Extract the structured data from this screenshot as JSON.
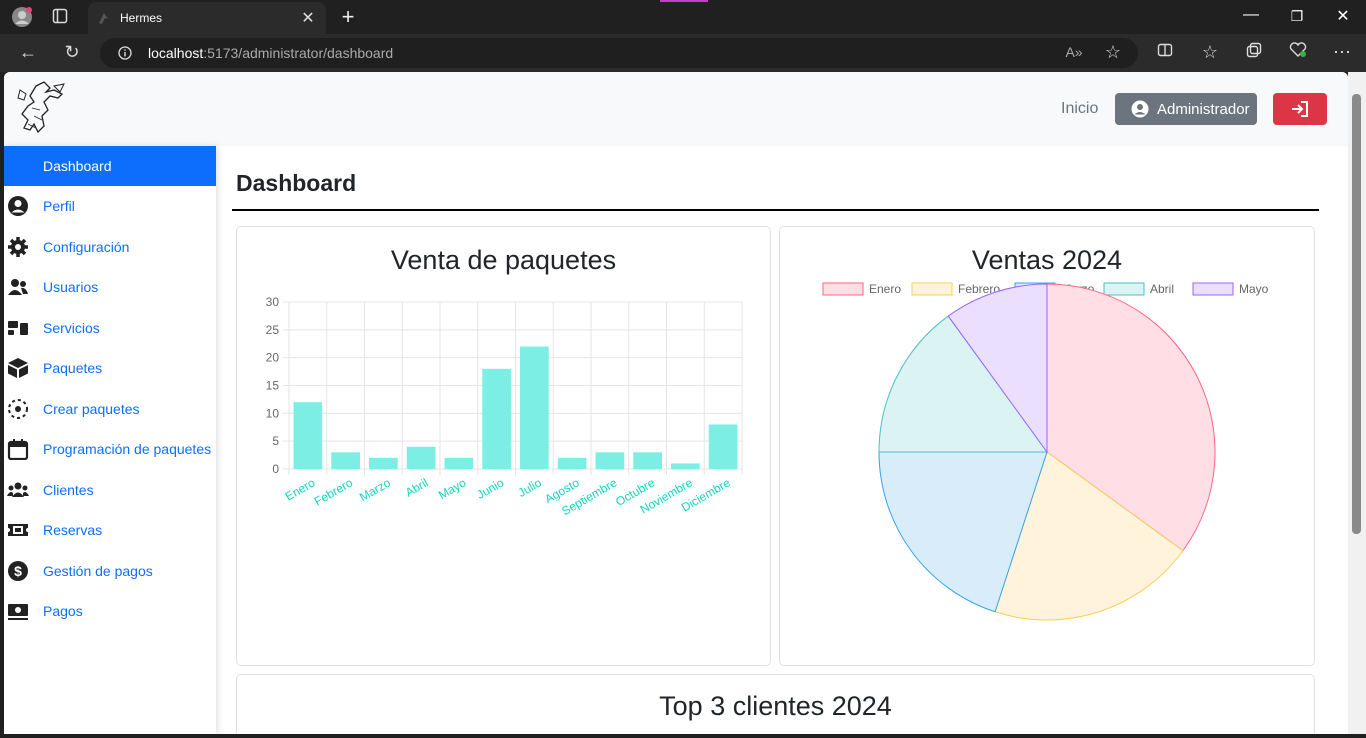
{
  "browser": {
    "tab_title": "Hermes",
    "url_host": "localhost",
    "url_path": ":5173/administrator/dashboard"
  },
  "topnav": {
    "inicio": "Inicio",
    "admin_label": "Administrador"
  },
  "sidebar": {
    "items": [
      {
        "label": "Dashboard",
        "icon": "chart-pie-icon"
      },
      {
        "label": "Perfil",
        "icon": "user-circle-icon"
      },
      {
        "label": "Configuración",
        "icon": "gear-icon"
      },
      {
        "label": "Usuarios",
        "icon": "users-icon"
      },
      {
        "label": "Servicios",
        "icon": "services-icon"
      },
      {
        "label": "Paquetes",
        "icon": "box-icon"
      },
      {
        "label": "Crear paquetes",
        "icon": "create-package-icon"
      },
      {
        "label": "Programación de paquetes",
        "icon": "calendar-icon"
      },
      {
        "label": "Clientes",
        "icon": "clients-icon"
      },
      {
        "label": "Reservas",
        "icon": "ticket-icon"
      },
      {
        "label": "Gestión de pagos",
        "icon": "dollar-icon"
      },
      {
        "label": "Pagos",
        "icon": "money-icon"
      }
    ]
  },
  "main": {
    "title": "Dashboard",
    "card3_title": "Top 3 clientes 2024"
  },
  "chart_data": [
    {
      "type": "bar",
      "title": "Venta de paquetes",
      "categories": [
        "Enero",
        "Febrero",
        "Marzo",
        "Abril",
        "Mayo",
        "Junio",
        "Julio",
        "Agosto",
        "Septiembre",
        "Octubre",
        "Noviembre",
        "Diciembre"
      ],
      "values": [
        12,
        3,
        2,
        4,
        2,
        18,
        22,
        2,
        3,
        3,
        1,
        8
      ],
      "ylim": [
        0,
        30
      ],
      "yticks": [
        0,
        5,
        10,
        15,
        20,
        25,
        30
      ],
      "grid": true,
      "color": "#7deee3",
      "label_color": "#13d6c3"
    },
    {
      "type": "pie",
      "title": "Ventas 2024",
      "legend_position": "top",
      "labels": [
        "Enero",
        "Febrero",
        "Marzo",
        "Abril",
        "Mayo"
      ],
      "values": [
        35,
        20,
        20,
        15,
        10
      ],
      "fill_colors": [
        "#ffdfe5",
        "#fff3db",
        "#d9ecf9",
        "#dbf3f3",
        "#ebdfff"
      ],
      "border_colors": [
        "#ff6384",
        "#ffcd56",
        "#36a2eb",
        "#4bc0c0",
        "#9966ff"
      ]
    }
  ]
}
